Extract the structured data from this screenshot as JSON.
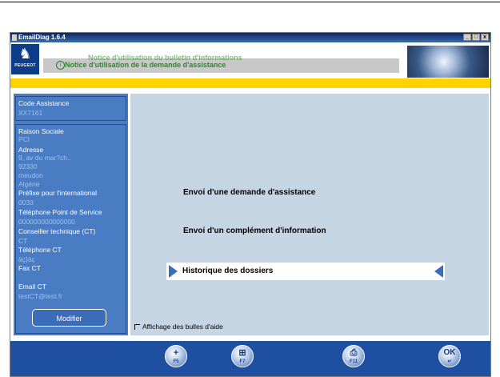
{
  "window": {
    "title": "EmailDiag 1.6.4",
    "buttons": [
      "_",
      "□",
      "x"
    ]
  },
  "header": {
    "logo_brand": "PEUGEOT",
    "notice_ghost": "Notice d'utilisation du bulletin d'informations",
    "notice_text": "Notice d'utilisation de la demande d'assistance"
  },
  "sidebar": {
    "code_label": "Code Assistance",
    "code_value": "XX7161",
    "fields": [
      {
        "label": "Raison Sociale",
        "value": "PCI"
      },
      {
        "label": "Adresse",
        "value": "9, av du mar?ch.."
      },
      {
        "label": "",
        "value": "92330"
      },
      {
        "label": "",
        "value": "meudon"
      },
      {
        "label": "",
        "value": "Algérie"
      },
      {
        "label": "Préfixe pour l'international",
        "value": "0033"
      },
      {
        "label": "Téléphone Point de Service",
        "value": "000000000000000"
      },
      {
        "label": "Conseiller technique (CT)",
        "value": "CT"
      },
      {
        "label": "Téléphone CT",
        "value": "äç}äç"
      },
      {
        "label": "Fax CT",
        "value": ""
      },
      {
        "label": "Email CT",
        "value": "testCT@test.fr"
      }
    ],
    "modify_button": "Modifier"
  },
  "main": {
    "option1": "Envoi d'une demande d'assistance",
    "option2": "Envoi d'un complément d'information",
    "option3": "Historique des dossiers",
    "help_checkbox": "Affichage des bulles d'aide"
  },
  "toolbar": [
    {
      "icon": "add-icon",
      "glyph": "+",
      "key": "F5"
    },
    {
      "icon": "edit-icon",
      "glyph": "⊞",
      "key": "F7"
    },
    {
      "icon": "print-icon",
      "glyph": "⎙",
      "key": "F11"
    },
    {
      "icon": "ok-icon",
      "glyph": "OK",
      "key": "↵"
    }
  ],
  "colors": {
    "sidebar_bg": "#4a7cc4",
    "main_bg": "#c6d5e3",
    "accent_yellow": "#ffd200",
    "toolbar_bg": "#1f4fa0",
    "notice_green": "#2a8a2a"
  }
}
